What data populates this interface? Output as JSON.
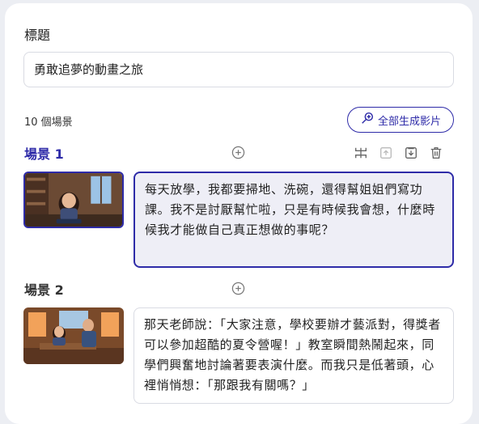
{
  "title_label": "標題",
  "title_value": "勇敢追夢的動畫之旅",
  "scene_count": "10 個場景",
  "generate_all_label": "全部生成影片",
  "scenes": [
    {
      "title": "場景 1",
      "text": "每天放學，我都要掃地、洗碗，還得幫姐姐們寫功課。我不是討厭幫忙啦，只是有時候我會想，什麼時候我才能做自己真正想做的事呢？"
    },
    {
      "title": "場景 2",
      "text": "那天老師說：「大家注意，學校要辦才藝派對，得獎者可以參加超酷的夏令營喔！」教室瞬間熱鬧起來，同學們興奮地討論著要表演什麼。而我只是低著頭，心裡悄悄想：「那跟我有關嗎？」"
    }
  ],
  "colors": {
    "accent": "#2e2ba8",
    "selected_bg": "#eeeef6"
  }
}
